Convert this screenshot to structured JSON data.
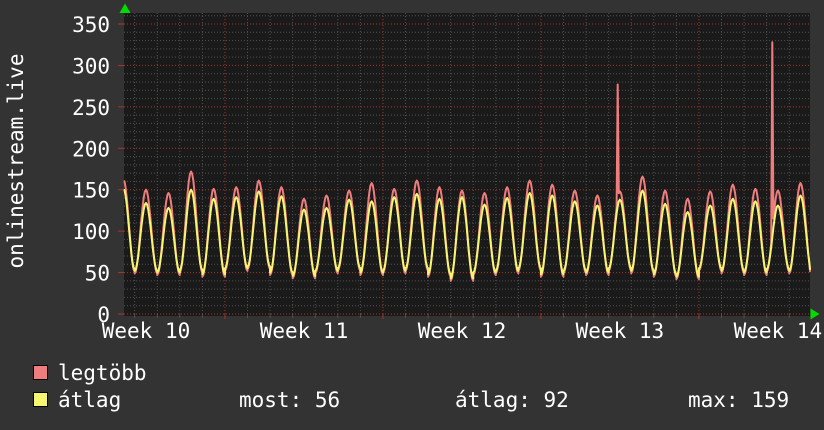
{
  "title": "onlinestream.live",
  "colors": {
    "background": "#333333",
    "plot_background": "#1a1a1a",
    "grid_minor": "#525252",
    "grid_major": "#a03830",
    "series_max": "#f07d7d",
    "series_avg": "#f6f671",
    "arrow": "#00dc00",
    "text": "#ffffff"
  },
  "chart_data": {
    "type": "line",
    "title": "onlinestream.live",
    "xlabel": "",
    "ylabel": "",
    "ylim": [
      0,
      363
    ],
    "y_ticks": [
      0,
      50,
      100,
      150,
      200,
      250,
      300,
      350
    ],
    "x_tick_labels": [
      "Week 10",
      "Week 11",
      "Week 12",
      "Week 13",
      "Week 14"
    ],
    "grid": true,
    "legend_position": "bottom-left",
    "series": [
      {
        "name": "legtöbb",
        "color": "#f07d7d",
        "role": "daily_max"
      },
      {
        "name": "átlag",
        "color": "#f6f671",
        "role": "daily_average"
      }
    ],
    "daily_cycles_note": "one cycle per day; peaks near midday, troughs near midnight; index 0 is the partial day at the left edge (Week 10), index 30 is the partial day at the right edge (Week 14)",
    "daily_cycles": [
      {
        "max_peak": 163,
        "avg_peak": 152,
        "trough": 54
      },
      {
        "max_peak": 150,
        "avg_peak": 134,
        "trough": 52
      },
      {
        "max_peak": 146,
        "avg_peak": 128,
        "trough": 50
      },
      {
        "max_peak": 172,
        "avg_peak": 150,
        "trough": 53
      },
      {
        "max_peak": 151,
        "avg_peak": 139,
        "trough": 48
      },
      {
        "max_peak": 153,
        "avg_peak": 141,
        "trough": 55
      },
      {
        "max_peak": 161,
        "avg_peak": 148,
        "trough": 57
      },
      {
        "max_peak": 153,
        "avg_peak": 142,
        "trough": 50
      },
      {
        "max_peak": 139,
        "avg_peak": 126,
        "trough": 46
      },
      {
        "max_peak": 143,
        "avg_peak": 128,
        "trough": 52
      },
      {
        "max_peak": 149,
        "avg_peak": 138,
        "trough": 55
      },
      {
        "max_peak": 158,
        "avg_peak": 136,
        "trough": 50
      },
      {
        "max_peak": 151,
        "avg_peak": 141,
        "trough": 52
      },
      {
        "max_peak": 161,
        "avg_peak": 145,
        "trough": 55
      },
      {
        "max_peak": 153,
        "avg_peak": 139,
        "trough": 48
      },
      {
        "max_peak": 149,
        "avg_peak": 141,
        "trough": 43
      },
      {
        "max_peak": 146,
        "avg_peak": 132,
        "trough": 50
      },
      {
        "max_peak": 153,
        "avg_peak": 140,
        "trough": 52
      },
      {
        "max_peak": 161,
        "avg_peak": 146,
        "trough": 55
      },
      {
        "max_peak": 156,
        "avg_peak": 143,
        "trough": 48
      },
      {
        "max_peak": 149,
        "avg_peak": 136,
        "trough": 52
      },
      {
        "max_peak": 143,
        "avg_peak": 131,
        "trough": 50
      },
      {
        "max_peak": 148,
        "avg_peak": 138,
        "trough": 55
      },
      {
        "max_peak": 166,
        "avg_peak": 149,
        "trough": 52
      },
      {
        "max_peak": 149,
        "avg_peak": 133,
        "trough": 48
      },
      {
        "max_peak": 139,
        "avg_peak": 123,
        "trough": 45
      },
      {
        "max_peak": 148,
        "avg_peak": 131,
        "trough": 55
      },
      {
        "max_peak": 156,
        "avg_peak": 139,
        "trough": 52
      },
      {
        "max_peak": 151,
        "avg_peak": 136,
        "trough": 50
      },
      {
        "max_peak": 149,
        "avg_peak": 131,
        "trough": 54
      },
      {
        "max_peak": 158,
        "avg_peak": 143,
        "trough": 52
      }
    ],
    "spikes": [
      {
        "day_index": 22,
        "frac": 0.38,
        "value": 277,
        "series": "legtöbb"
      },
      {
        "day_index": 29,
        "frac": 0.25,
        "value": 328,
        "series": "legtöbb"
      }
    ],
    "stats": {
      "most": 56,
      "atlag": 92,
      "max": 159
    }
  },
  "legend": {
    "items": [
      {
        "label": "legtöbb",
        "color": "#f07d7d"
      },
      {
        "label": "átlag",
        "color": "#f6f671"
      }
    ]
  },
  "stats_row": {
    "most": "most: 56",
    "atlag": "átlag: 92",
    "max": "max: 159"
  }
}
